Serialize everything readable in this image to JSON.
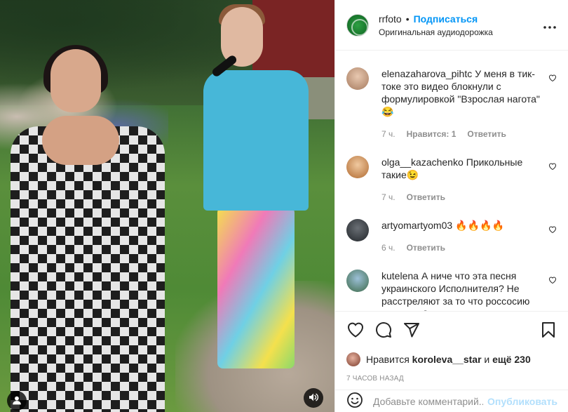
{
  "header": {
    "username": "rrfoto",
    "separator": "•",
    "follow_label": "Подписаться",
    "audio_label": "Оригинальная аудиодорожка",
    "more_icon": "more-horizontal-icon"
  },
  "comments": [
    {
      "user": "elenazaharova_pihtc",
      "text": "У меня в тик-токе это видео блокнули с формулировкой \"Взрослая нагота\" 😂",
      "time": "7 ч.",
      "likes": "Нравится: 1",
      "reply": "Ответить",
      "avatar_color": "#c9a488"
    },
    {
      "user": "olga__kazachenko",
      "text": "Прикольные такие😉",
      "time": "7 ч.",
      "likes": "",
      "reply": "Ответить",
      "avatar_color": "#d0874e"
    },
    {
      "user": "artyomartyom03",
      "text": "🔥🔥🔥🔥",
      "time": "6 ч.",
      "likes": "",
      "reply": "Ответить",
      "avatar_color": "#3a3f45"
    },
    {
      "user": "kutelena",
      "text": "А ниче что эта песня украинского Исполнителя? Не расстреляют за то что россосию предали ?",
      "time": "",
      "likes": "",
      "reply": "",
      "avatar_color": "#5f8fb0"
    }
  ],
  "actions": {
    "like_icon": "heart-icon",
    "comment_icon": "comment-icon",
    "share_icon": "send-icon",
    "save_icon": "bookmark-icon"
  },
  "likes": {
    "prefix": "Нравится",
    "user": "koroleva__star",
    "conj": "и",
    "more": "ещё 230"
  },
  "post_time": "7 ЧАСОВ НАЗАД",
  "add_comment": {
    "placeholder": "Добавьте комментарий...",
    "post_label": "Опубликовать"
  },
  "colors": {
    "accent": "#0095f6",
    "muted": "#8e8e8e",
    "text": "#262626",
    "post_disabled": "#b2dffc"
  }
}
